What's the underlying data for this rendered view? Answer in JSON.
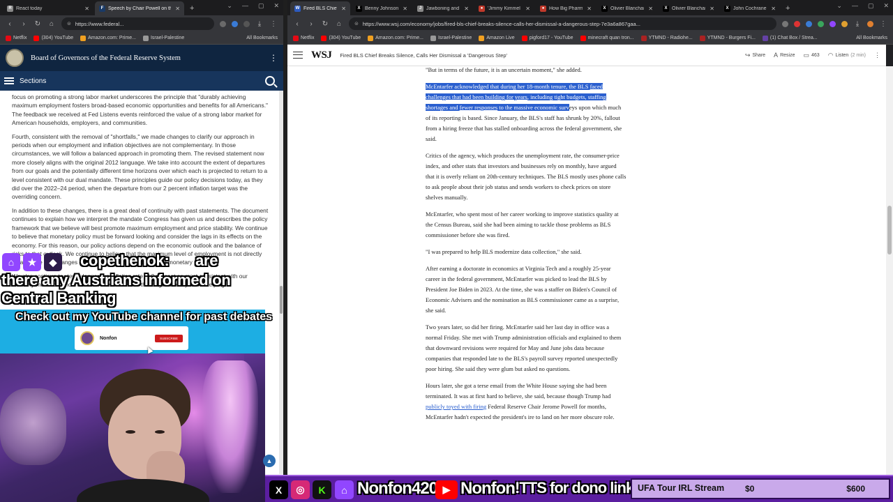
{
  "left_window": {
    "tabs": [
      {
        "title": "React today",
        "favicon_color": "#888888",
        "active": false
      },
      {
        "title": "Speech by Chair Powell on the",
        "favicon_color": "#1a3a66",
        "active": true
      }
    ],
    "url": "https://www.federal...",
    "bookmarks": [
      {
        "label": "Netflix",
        "color": "#e50914"
      },
      {
        "label": "(304) YouTube",
        "color": "#ff0000"
      },
      {
        "label": "Amazon.com: Prime...",
        "color": "#f0a020"
      },
      {
        "label": "Israel-Palestine",
        "color": "#999999"
      },
      {
        "label": "All Bookmarks",
        "color": "#999999"
      }
    ]
  },
  "fed_page": {
    "site_title": "Board of Governors of the Federal Reserve System",
    "sections_label": "Sections",
    "paragraphs": [
      "focus on promoting a strong labor market underscores the principle that \"durably achieving maximum employment fosters broad-based economic opportunities and benefits for all Americans.\" The feedback we received at Fed Listens events reinforced the value of a strong labor market for American households, employers, and communities.",
      "Fourth, consistent with the removal of \"shortfalls,\" we made changes to clarify our approach in periods when our employment and inflation objectives are not complementary. In those circumstances, we will follow a balanced approach in promoting them. The revised statement now more closely aligns with the original 2012 language. We take into account the extent of departures from our goals and the potentially different time horizons over which each is projected to return to a level consistent with our dual mandate. These principles guide our policy decisions today, as they did over the 2022–24 period, when the departure from our 2 percent inflation target was the overriding concern.",
      "In addition to these changes, there is a great deal of continuity with past statements. The document continues to explain how we interpret the mandate Congress has given us and describes the policy framework that we believe will best promote maximum employment and price stability. We continue to believe that monetary policy must be forward looking and consider the lags in its effects on the economy. For this reason, our policy actions depend on the economic outlook and the balance of risks to that outlook. We continue to believe that the maximum level of employment is not directly measurable and changes over time for reasons unrelated to monetary policy.",
      "We also continue to view a longer-run inflation rate of 2 percent as most consistent with our statutory mandate, and that a firm commitment to this target is a key factor helping"
    ]
  },
  "right_window": {
    "tabs": [
      {
        "title": "Fired BLS Chief B",
        "favicon_color": "#2d5bbf",
        "active": true
      },
      {
        "title": "Benny Johnson o",
        "favicon_color": "#000000",
        "active": false
      },
      {
        "title": "Jawboning and n",
        "favicon_color": "#888888",
        "active": false
      },
      {
        "title": "'Jimmy Kimmel",
        "favicon_color": "#c0392b",
        "active": false
      },
      {
        "title": "How Big Pharma",
        "favicon_color": "#c0392b",
        "active": false
      },
      {
        "title": "Olivier Blanchar",
        "favicon_color": "#000000",
        "active": false
      },
      {
        "title": "Olivier Blanchar",
        "favicon_color": "#000000",
        "active": false
      },
      {
        "title": "John Cochrane o",
        "favicon_color": "#000000",
        "active": false
      }
    ],
    "url": "https://www.wsj.com/economy/jobs/fired-bls-chief-breaks-silence-calls-her-dismissal-a-dangerous-step-7e3a6a867gaa...",
    "bookmarks": [
      {
        "label": "Netflix",
        "color": "#e50914"
      },
      {
        "label": "(304) YouTube",
        "color": "#ff0000"
      },
      {
        "label": "Amazon.com: Prime...",
        "color": "#f0a020"
      },
      {
        "label": "Israel-Palestine",
        "color": "#999999"
      },
      {
        "label": "Amazon Live",
        "color": "#f0a020"
      },
      {
        "label": "pigford17 - YouTube",
        "color": "#ff0000"
      },
      {
        "label": "minecraft quan tron...",
        "color": "#ff0000"
      },
      {
        "label": "YTMND - Radiohe...",
        "color": "#aa2222"
      },
      {
        "label": "YTMND - Burgers Fi...",
        "color": "#aa2222"
      },
      {
        "label": "(1) Chat Box / Strea...",
        "color": "#6441a5"
      },
      {
        "label": "All Bookmarks",
        "color": "#999999"
      }
    ]
  },
  "wsj_page": {
    "logo": "WSJ",
    "headline": "Fired BLS Chief Breaks Silence, Calls Her Dismissal a 'Dangerous Step'",
    "share_label": "Share",
    "resize_label": "Resize",
    "comments_count": "463",
    "listen_label": "Listen",
    "listen_duration": "(2 min)",
    "article": {
      "p0": "\"But in terms of the future, it is an uncertain moment,\" she added.",
      "p1_highlight_a": "McEntarfer acknowledged that during her 18-month tenure, the BLS ",
      "p1_link_a": "faced challenges that had been building for years",
      "p1_highlight_b": ", including tight budgets, staffing shortages and ",
      "p1_link_b": "fewer responses",
      "p1_highlight_c": " to the massive economic surv",
      "p1_rest": "eys upon which much of its reporting is based. Since January, the BLS's staff has shrunk by 20%, fallout from a hiring freeze that has stalled onboarding across the federal government, she said.",
      "p2": "Critics of the agency, which produces the unemployment rate, the consumer-price index, and other stats that investors and businesses rely on monthly, have argued that it is overly reliant on 20th-century techniques. The BLS mostly uses phone calls to ask people about their job status and sends workers to check prices on store shelves manually.",
      "p3": "McEntarfer, who spent most of her career working to improve statistics quality at the Census Bureau, said she had been aiming to tackle those problems as BLS commissioner before she was fired.",
      "p4": "\"I was prepared to help BLS modernize data collection,\" she said.",
      "p5": "After earning a doctorate in economics at Virginia Tech and a roughly 25-year career in the federal government, McEntarfer was picked to lead the BLS by President Joe Biden in 2023. At the time, she was a staffer on Biden's Council of Economic Advisers and the nomination as BLS commissioner came as a surprise, she said.",
      "p6": "Two years later, so did her firing. McEntarfer said her last day in office was a normal Friday. She met with Trump administration officials and explained to them that downward revisions were required for May and June jobs data because companies that responded late to the BLS's payroll survey reported unexpectedly poor hiring. She said they were glum but asked no questions.",
      "p7_a": "Hours later, she got a terse email from the White House saying she had been terminated. It was at first hard to believe, she said, because though Trump had ",
      "p7_link": "publicly toyed with firing",
      "p7_b": " Federal Reserve Chair Jerome Powell for months, McEntarfer hadn't expected the president's ire to land on her more obscure role."
    }
  },
  "stream": {
    "chat_user": "copethenok:",
    "chat_line1": "are",
    "chat_line2": "there any Austrians informed on",
    "chat_line3": "Central Banking",
    "promo_text": "Check out my YouTube channel for past debates",
    "yt_channel": "Nonfon",
    "yt_subtext": "",
    "yt_button": "SUBSCRIBE",
    "handle_1": "Nonfon420",
    "handle_2": "Nonfon",
    "tts_text": "!TTS for dono link",
    "goal_title": "UFA Tour IRL Stream",
    "goal_current": "$0",
    "goal_target": "$600",
    "colors": {
      "twitch": "#9146ff",
      "youtube": "#ff0000",
      "instagram": "#d62976",
      "kick": "#53fc18",
      "overlay_purple": "#5b1ea0",
      "promo_blue": "#1daee3"
    }
  }
}
